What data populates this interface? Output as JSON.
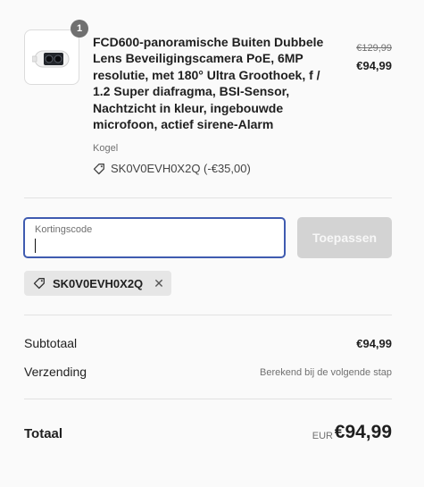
{
  "cart": {
    "item": {
      "quantity": "1",
      "title": "FCD600-panoramische Buiten Dubbele Lens Beveiligingscamera PoE, 6MP resolutie, met 180° Ultra Groothoek, f / 1.2 Super diafragma, BSI-Sensor, Nachtzicht in kleur, ingebouwde microfoon, actief sirene-Alarm",
      "variant": "Kogel",
      "discount": "SK0V0EVH0X2Q (-€35,00)",
      "original_price": "€129,99",
      "price": "€94,99",
      "image_icon": "security-camera-icon"
    }
  },
  "discount": {
    "placeholder": "Kortingscode",
    "value": "",
    "apply_label": "Toepassen",
    "applied_code": "SK0V0EVH0X2Q",
    "tag_icon": "tag-icon",
    "remove_icon": "close-icon"
  },
  "summary": {
    "subtotal_label": "Subtotaal",
    "subtotal_value": "€94,99",
    "shipping_label": "Verzending",
    "shipping_value": "Berekend bij de volgende stap",
    "total_label": "Totaal",
    "currency": "EUR",
    "total_value": "€94,99"
  },
  "colors": {
    "focus_border": "#3f5bb0",
    "button_disabled": "#d3d3d3",
    "chip_bg": "#e6e6e6"
  }
}
